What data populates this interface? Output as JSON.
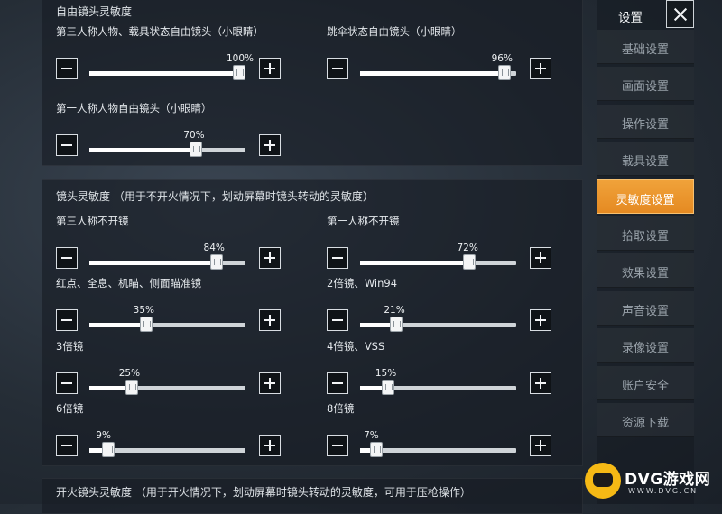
{
  "free_camera": {
    "title": "自由镜头灵敏度",
    "sliders": [
      {
        "label": "第三人称人物、载具状态自由镜头（小眼睛）",
        "value": 100,
        "display": "100%"
      },
      {
        "label": "跳伞状态自由镜头（小眼睛）",
        "value": 96,
        "display": "96%"
      },
      {
        "label": "第一人称人物自由镜头（小眼睛）",
        "value": 70,
        "display": "70%"
      }
    ]
  },
  "camera": {
    "title": "镜头灵敏度 （用于不开火情况下，划动屏幕时镜头转动的灵敏度）",
    "sliders": [
      {
        "label": "第三人称不开镜",
        "value": 84,
        "display": "84%"
      },
      {
        "label": "第一人称不开镜",
        "value": 72,
        "display": "72%"
      },
      {
        "label": "红点、全息、机瞄、侧面瞄准镜",
        "value": 35,
        "display": "35%"
      },
      {
        "label": "2倍镜、Win94",
        "value": 21,
        "display": "21%"
      },
      {
        "label": "3倍镜",
        "value": 25,
        "display": "25%"
      },
      {
        "label": "4倍镜、VSS",
        "value": 15,
        "display": "15%"
      },
      {
        "label": "6倍镜",
        "value": 9,
        "display": "9%"
      },
      {
        "label": "8倍镜",
        "value": 7,
        "display": "7%"
      }
    ]
  },
  "fire_camera": {
    "title": "开火镜头灵敏度 （用于开火情况下，划动屏幕时镜头转动的灵敏度，可用于压枪操作）"
  },
  "menu": {
    "title": "设置",
    "items": [
      "基础设置",
      "画面设置",
      "操作设置",
      "载具设置",
      "灵敏度设置",
      "拾取设置",
      "效果设置",
      "声音设置",
      "录像设置",
      "账户安全",
      "资源下载"
    ],
    "active_index": 4
  },
  "watermark": {
    "text": "DVG游戏网",
    "sub": "WWW.DVG.CN"
  }
}
